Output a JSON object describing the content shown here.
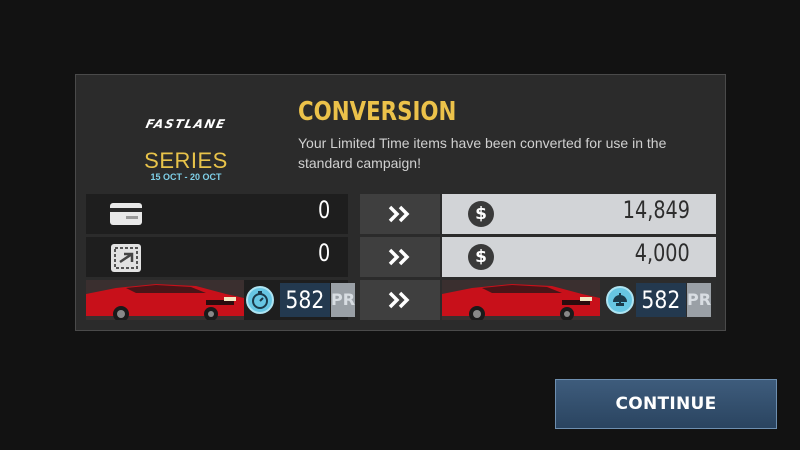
{
  "event": {
    "logo": "FASTLANE",
    "series": "SERIES",
    "dates": "15 OCT - 20 OCT"
  },
  "conversion": {
    "title": "CONVERSION",
    "description": "Your Limited Time items have been converted for use in the standard campaign!"
  },
  "rows": [
    {
      "left_icon": "card-icon",
      "left_value": "0",
      "arrow_icon": "double-chevron-right-icon",
      "right_icon": "cash-icon",
      "right_symbol": "$",
      "right_value": "14,849"
    },
    {
      "left_icon": "voucher-icon",
      "left_value": "0",
      "arrow_icon": "double-chevron-right-icon",
      "right_icon": "cash-icon",
      "right_symbol": "$",
      "right_value": "4,000"
    },
    {
      "left_icon": "stopwatch-icon",
      "left_value": "582",
      "left_tag": "PR",
      "arrow_icon": "double-chevron-right-icon",
      "right_icon": "engine-icon",
      "right_value": "582",
      "right_tag": "PR"
    }
  ],
  "arrow_glyph": "»",
  "car": {
    "color": "#c8101a"
  },
  "continue_label": "CONTINUE",
  "colors": {
    "accent": "#ecc24a",
    "dates": "#7fd0e8",
    "pr_badge": "#67c6e3",
    "button": "#34506e"
  }
}
